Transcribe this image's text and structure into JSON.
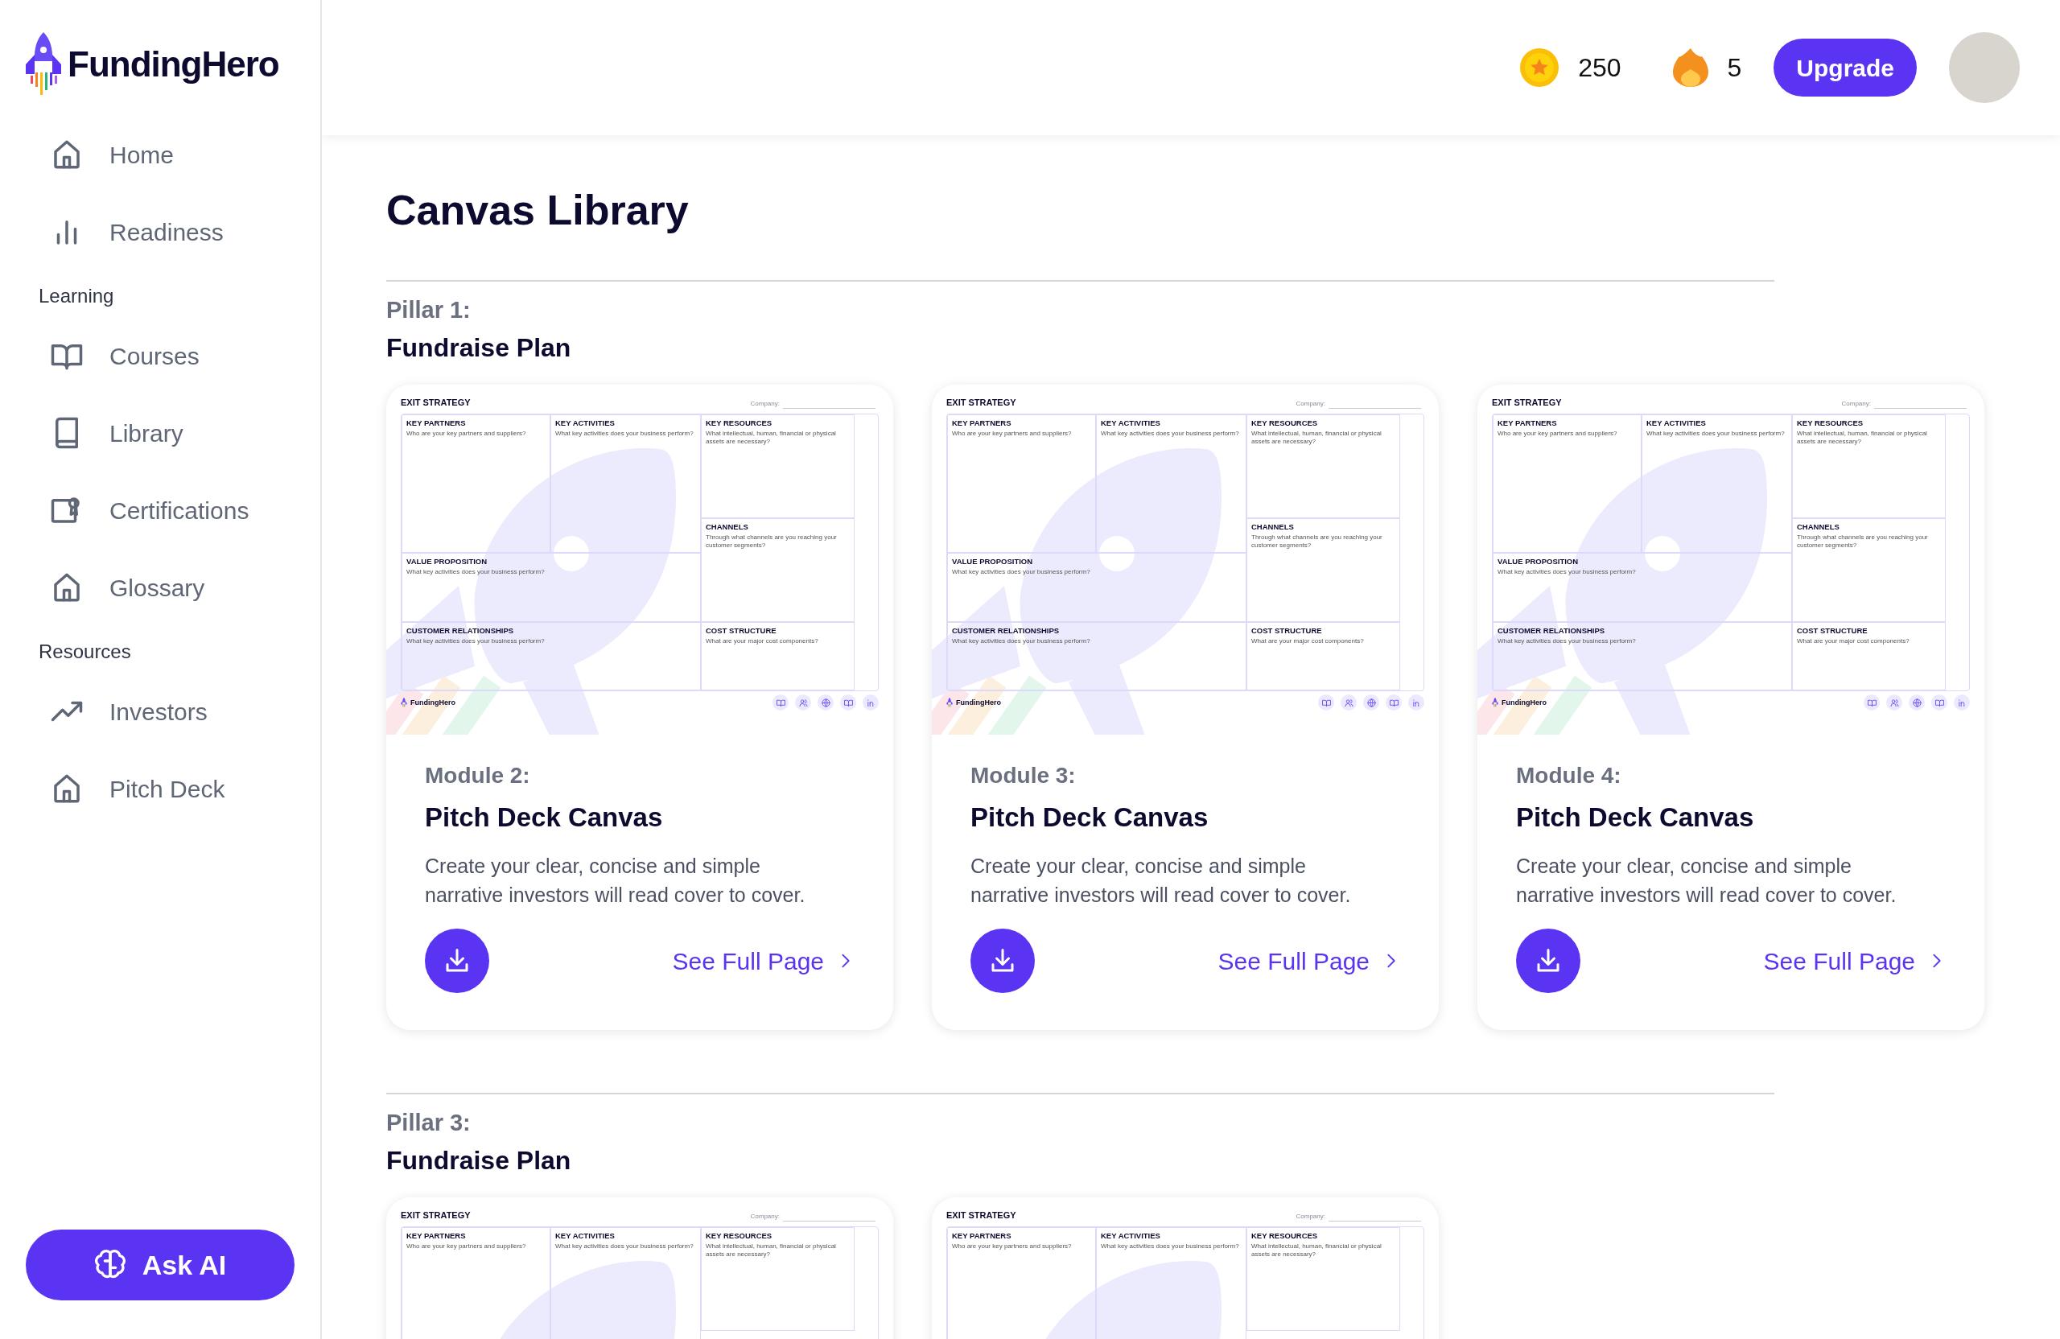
{
  "brand": {
    "name": "FundingHero"
  },
  "sidebar": {
    "items": [
      {
        "label": "Home"
      },
      {
        "label": "Readiness"
      }
    ],
    "sections": [
      {
        "title": "Learning",
        "items": [
          {
            "label": "Courses"
          },
          {
            "label": "Library"
          },
          {
            "label": "Certifications"
          },
          {
            "label": "Glossary"
          }
        ]
      },
      {
        "title": "Resources",
        "items": [
          {
            "label": "Investors"
          },
          {
            "label": "Pitch Deck"
          }
        ]
      }
    ],
    "ask_button": "Ask AI"
  },
  "topbar": {
    "coins": "250",
    "streak": "5",
    "upgrade_button": "Upgrade"
  },
  "page_title": "Canvas Library",
  "pillars": [
    {
      "label": "Pillar 1:",
      "title": "Fundraise Plan",
      "cards": [
        {
          "canvas": {
            "heading": "EXIT STRATEGY",
            "company_label": "Company:",
            "cells": [
              {
                "title": "KEY PARTNERS",
                "question": "Who are your key partners and suppliers?"
              },
              {
                "title": "KEY ACTIVITIES",
                "question": "What key activities does your business perform?"
              },
              {
                "title": "KEY RESOURCES",
                "question": "What intellectual, human, financial or physical assets are necessary?"
              },
              {
                "title": "CHANNELS",
                "question": "Through what channels are you reaching your customer segments?"
              },
              {
                "title": "VALUE PROPOSITION",
                "question": "What key activities does your business perform?"
              },
              {
                "title": "CUSTOMER RELATIONSHIPS",
                "question": "What key activities does your business perform?"
              },
              {
                "title": "COST STRUCTURE",
                "question": "What are your major cost components?"
              }
            ],
            "brand": "FundingHero"
          },
          "module": "Module 2:",
          "title": "Pitch Deck Canvas",
          "description": "Create your clear, concise and simple narrative investors will read cover to cover.",
          "link": "See Full Page"
        },
        {
          "canvas": {
            "heading": "EXIT STRATEGY",
            "company_label": "Company:",
            "cells": [
              {
                "title": "KEY PARTNERS",
                "question": "Who are your key partners and suppliers?"
              },
              {
                "title": "KEY ACTIVITIES",
                "question": "What key activities does your business perform?"
              },
              {
                "title": "KEY RESOURCES",
                "question": "What intellectual, human, financial or physical assets are necessary?"
              },
              {
                "title": "CHANNELS",
                "question": "Through what channels are you reaching your customer segments?"
              },
              {
                "title": "VALUE PROPOSITION",
                "question": "What key activities does your business perform?"
              },
              {
                "title": "CUSTOMER RELATIONSHIPS",
                "question": "What key activities does your business perform?"
              },
              {
                "title": "COST STRUCTURE",
                "question": "What are your major cost components?"
              }
            ],
            "brand": "FundingHero"
          },
          "module": "Module 3:",
          "title": "Pitch Deck Canvas",
          "description": "Create your clear, concise and simple narrative investors will read cover to cover.",
          "link": "See Full Page"
        },
        {
          "canvas": {
            "heading": "EXIT STRATEGY",
            "company_label": "Company:",
            "cells": [
              {
                "title": "KEY PARTNERS",
                "question": "Who are your key partners and suppliers?"
              },
              {
                "title": "KEY ACTIVITIES",
                "question": "What key activities does your business perform?"
              },
              {
                "title": "KEY RESOURCES",
                "question": "What intellectual, human, financial or physical assets are necessary?"
              },
              {
                "title": "CHANNELS",
                "question": "Through what channels are you reaching your customer segments?"
              },
              {
                "title": "VALUE PROPOSITION",
                "question": "What key activities does your business perform?"
              },
              {
                "title": "CUSTOMER RELATIONSHIPS",
                "question": "What key activities does your business perform?"
              },
              {
                "title": "COST STRUCTURE",
                "question": "What are your major cost components?"
              }
            ],
            "brand": "FundingHero"
          },
          "module": "Module 4:",
          "title": "Pitch Deck Canvas",
          "description": "Create your clear, concise and simple narrative investors will read cover to cover.",
          "link": "See Full Page"
        }
      ]
    },
    {
      "label": "Pillar 3:",
      "title": "Fundraise Plan",
      "cards": [
        {
          "canvas": {
            "heading": "EXIT STRATEGY",
            "company_label": "Company:",
            "cells": [
              {
                "title": "KEY PARTNERS",
                "question": "Who are your key partners and suppliers?"
              },
              {
                "title": "KEY ACTIVITIES",
                "question": "What key activities does your business perform?"
              },
              {
                "title": "KEY RESOURCES",
                "question": "What intellectual, human, financial or physical assets are necessary?"
              }
            ]
          }
        },
        {
          "canvas": {
            "heading": "EXIT STRATEGY",
            "company_label": "Company:",
            "cells": [
              {
                "title": "KEY PARTNERS",
                "question": "Who are your key partners and suppliers?"
              },
              {
                "title": "KEY ACTIVITIES",
                "question": "What key activities does your business perform?"
              },
              {
                "title": "KEY RESOURCES",
                "question": "What intellectual, human, financial or physical assets are necessary?"
              }
            ]
          }
        }
      ]
    }
  ]
}
